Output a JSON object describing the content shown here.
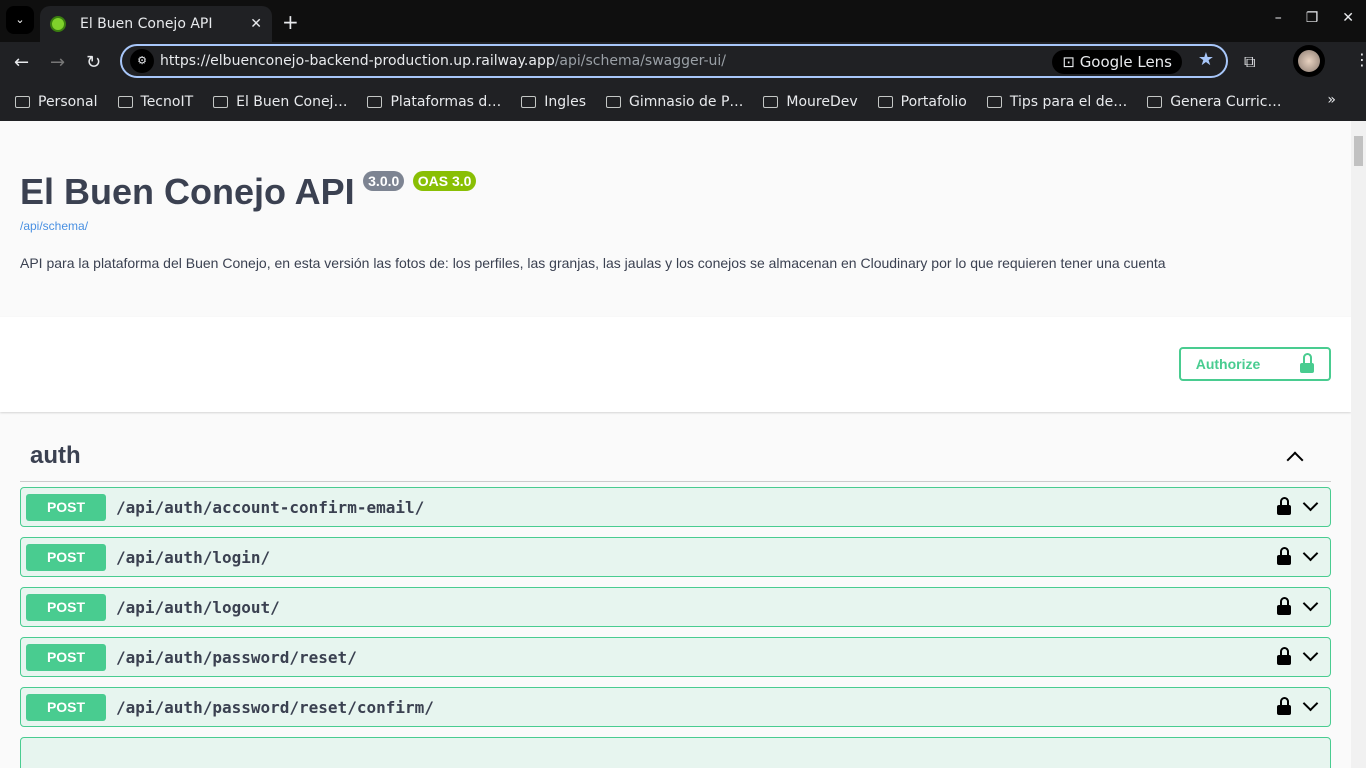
{
  "browser": {
    "tab_title": "El Buen Conejo API",
    "url_host": "https://elbuenconejo-backend-production.up.railway.app",
    "url_path": "/api/schema/swagger-ui/",
    "lens_label": "Google Lens",
    "bookmarks": [
      "Personal",
      "TecnoIT",
      "El Buen Conej…",
      "Plataformas d…",
      "Ingles",
      "Gimnasio de P…",
      "MoureDev",
      "Portafolio",
      "Tips para el de…",
      "Genera Curric…"
    ]
  },
  "info": {
    "title": "El Buen Conejo API",
    "version": "3.0.0",
    "oas": "OAS 3.0",
    "base_url": "/api/schema/",
    "description": "API para la plataforma del Buen Conejo, en esta versión las fotos de: los perfiles, las granjas, las jaulas y los conejos se almacenan en Cloudinary por lo que requieren tener una cuenta"
  },
  "authorize_label": "Authorize",
  "colors": {
    "post": "#49cc90",
    "accent": "#a8c7fa"
  },
  "tag": {
    "name": "auth",
    "operations": [
      {
        "method": "POST",
        "path": "/api/auth/account-confirm-email/"
      },
      {
        "method": "POST",
        "path": "/api/auth/login/"
      },
      {
        "method": "POST",
        "path": "/api/auth/logout/"
      },
      {
        "method": "POST",
        "path": "/api/auth/password/reset/"
      },
      {
        "method": "POST",
        "path": "/api/auth/password/reset/confirm/"
      }
    ]
  }
}
